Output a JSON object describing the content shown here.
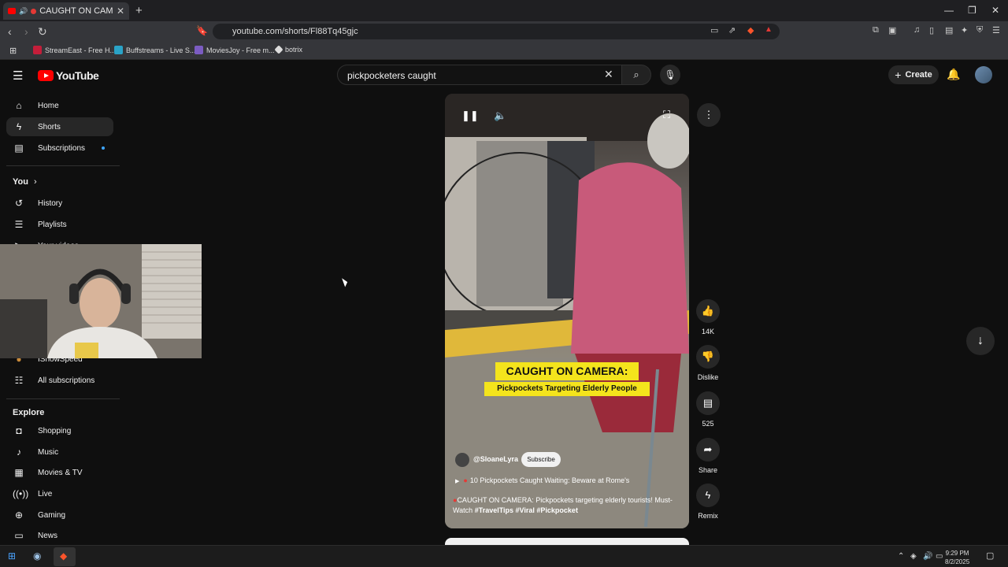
{
  "browser": {
    "tab_title": "CAUGHT ON CAMERA: Pic",
    "url": "youtube.com/shorts/Fl88Tq45gjc",
    "bookmarks": [
      "StreamEast - Free H...",
      "Buffstreams - Live S...",
      "MoviesJoy - Free m...",
      "botrix"
    ]
  },
  "header": {
    "logo_text": "YouTube",
    "search_value": "pickpocketers caught",
    "create_label": "Create"
  },
  "sidebar": {
    "main": [
      "Home",
      "Shorts",
      "Subscriptions"
    ],
    "you_heading": "You",
    "you_items": [
      "History",
      "Playlists",
      "Your videos"
    ],
    "subs_items": [
      "IShowSpeed",
      "All subscriptions"
    ],
    "explore_heading": "Explore",
    "explore_items": [
      "Shopping",
      "Music",
      "Movies & TV",
      "Live",
      "Gaming",
      "News"
    ]
  },
  "short": {
    "banner_title": "CAUGHT ON CAMERA:",
    "banner_subtitle": "Pickpockets Targeting Elderly People",
    "channel": "@SloaneLyra",
    "subscribe_label": "Subscribe",
    "playlist": "10 Pickpockets Caught Waiting: Beware at Rome's",
    "description": "CAUGHT ON CAMERA: Pickpockets targeting elderly tourists! Must-Watch",
    "hashtags": "#TravelTips #Viral #Pickpocket"
  },
  "actions": {
    "likes": "14K",
    "dislike_label": "Dislike",
    "comments": "525",
    "share_label": "Share",
    "remix_label": "Remix"
  },
  "taskbar": {
    "time": "9:29 PM",
    "date": "8/2/2025"
  }
}
